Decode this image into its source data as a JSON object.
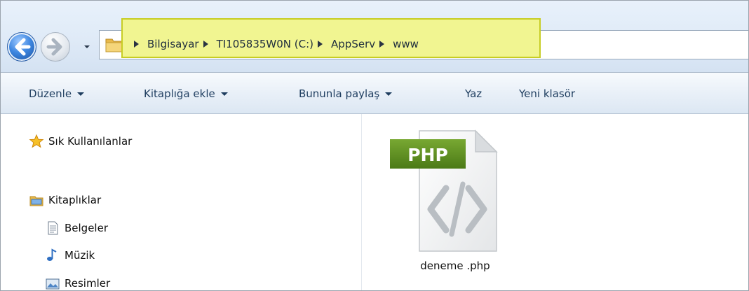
{
  "window": {
    "breadcrumbs": [
      "Bilgisayar",
      "TI105835W0N (C:)",
      "AppServ",
      "www"
    ]
  },
  "toolbar": {
    "organize_label": "Düzenle",
    "include_library_label": "Kitaplığa ekle",
    "share_with_label": "Bununla paylaş",
    "burn_label": "Yaz",
    "new_folder_label": "Yeni klasör"
  },
  "sidebar": {
    "favorites_label": "Sık Kullanılanlar",
    "libraries_label": "Kitaplıklar",
    "items": [
      {
        "label": "Belgeler",
        "icon": "document-icon"
      },
      {
        "label": "Müzik",
        "icon": "music-icon"
      },
      {
        "label": "Resimler",
        "icon": "pictures-icon"
      }
    ]
  },
  "files": [
    {
      "name": "deneme .php",
      "badge": "PHP",
      "icon": "php-file-icon"
    }
  ],
  "colors": {
    "highlight": "#f1f591",
    "php_badge": "#5f8f1e"
  }
}
